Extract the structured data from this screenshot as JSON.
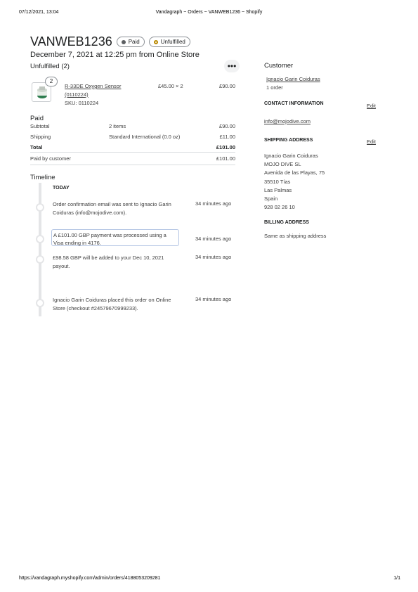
{
  "print_header": {
    "datetime": "07/12/2021, 13:04",
    "title": "Vandagraph ~ Orders ~ VANWEB1236 ~ Shopify"
  },
  "order": {
    "number": "VANWEB1236",
    "paid_badge": "Paid",
    "fulfillment_badge": "Unfulfilled",
    "subtitle": "December 7, 2021 at 12:25 pm from Online Store",
    "colors": {
      "paid_dot": "#5c5f62",
      "unfulfilled_dot": "#b98900"
    }
  },
  "unfulfilled": {
    "heading": "Unfulfilled (2)",
    "more_icon": "more-horizontal-icon",
    "item": {
      "quantity_badge": "2",
      "name_line1": "R-33DE Oxygen Sensor",
      "name_line2": "(0110224)",
      "sku": "SKU: 0110224",
      "unit_price": "£45.00 × 2",
      "total": "£90.00"
    }
  },
  "payment": {
    "heading": "Paid",
    "subtotal_label": "Subtotal",
    "subtotal_detail": "2 items",
    "subtotal_value": "£90.00",
    "shipping_label": "Shipping",
    "shipping_detail": "Standard International (0.0 oz)",
    "shipping_value": "£11.00",
    "total_label": "Total",
    "total_value": "£101.00",
    "paid_by_label": "Paid by customer",
    "paid_by_value": "£101.00"
  },
  "timeline": {
    "heading": "Timeline",
    "day_label": "TODAY",
    "events": [
      {
        "line1": "Order confirmation email was sent to Ignacio Garin",
        "line2": "Coiduras (info@mojodive.com).",
        "time": "34 minutes ago"
      },
      {
        "line1": "A £101.00 GBP payment was processed using a",
        "line2": "Visa ending in 4176.",
        "time": "34 minutes ago"
      },
      {
        "line1": "£98.58 GBP will be added to your Dec 10, 2021",
        "line2": "payout.",
        "time": "34 minutes ago"
      },
      {
        "line1": "Ignacio Garin Coiduras placed this order on Online",
        "line2": "Store (checkout #24579670999233).",
        "time": "34 minutes ago"
      }
    ]
  },
  "customer": {
    "heading": "Customer",
    "name": "Ignacio Garin Coiduras",
    "orders": "1 order",
    "contact_heading": "CONTACT INFORMATION",
    "contact_edit": "Edit",
    "email": "info@mojodive.com",
    "shipping_heading": "SHIPPING ADDRESS",
    "shipping_edit": "Edit",
    "address": [
      "Ignacio Garin Coiduras",
      "MOJO DIVE SL",
      "Avenida de las Playas, 75",
      "35510 Tías",
      "Las Palmas",
      "Spain",
      "928 02 26 10"
    ],
    "billing_heading": "BILLING ADDRESS",
    "billing_text": "Same as shipping address"
  },
  "print_footer": {
    "url": "https://vandagraph.myshopify.com/admin/orders/4188053209281",
    "page": "1/1"
  }
}
